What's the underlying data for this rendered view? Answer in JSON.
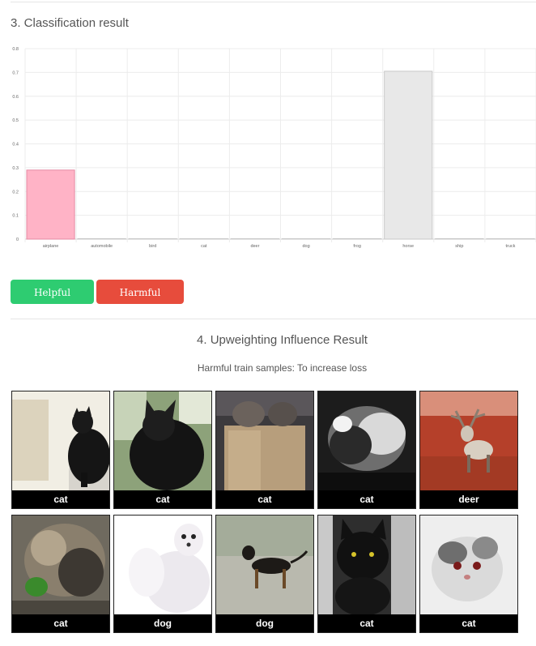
{
  "section3": {
    "title": "3. Classification result"
  },
  "chart_data": {
    "type": "bar",
    "categories": [
      "airplane",
      "automobile",
      "bird",
      "cat",
      "deer",
      "dog",
      "frog",
      "horse",
      "ship",
      "truck"
    ],
    "values": [
      0.29,
      0.002,
      0.0,
      0.0,
      0.0,
      0.0,
      0.002,
      0.705,
      0.002,
      0.0
    ],
    "ylim": [
      0,
      0.8
    ],
    "yticks": [
      "0",
      "0.1",
      "0.2",
      "0.3",
      "0.4",
      "0.5",
      "0.6",
      "0.7",
      "0.8"
    ],
    "bar_colors": [
      "#ffb3c6",
      "#e8e8e8",
      "#e8e8e8",
      "#e8e8e8",
      "#e8e8e8",
      "#e8e8e8",
      "#e8e8e8",
      "#e8e8e8",
      "#e8e8e8",
      "#e8e8e8"
    ],
    "bar_borders": [
      "#e58aa3",
      "#c8c8c8",
      "#c8c8c8",
      "#c8c8c8",
      "#c8c8c8",
      "#c8c8c8",
      "#c8c8c8",
      "#c8c8c8",
      "#c8c8c8",
      "#c8c8c8"
    ],
    "grid": true,
    "title": "",
    "xlabel": "",
    "ylabel": ""
  },
  "buttons": {
    "helpful": "Helpful samples",
    "harmful": "Harmful samples"
  },
  "section4": {
    "title": "4. Upweighting Influence Result",
    "subtitle": "Harmful train samples: To increase loss"
  },
  "samples": [
    {
      "label": "cat"
    },
    {
      "label": "cat"
    },
    {
      "label": "cat"
    },
    {
      "label": "cat"
    },
    {
      "label": "deer"
    },
    {
      "label": "cat"
    },
    {
      "label": "dog"
    },
    {
      "label": "dog"
    },
    {
      "label": "cat"
    },
    {
      "label": "cat"
    }
  ],
  "colors": {
    "helpful_button": "#2ecc71",
    "harmful_button": "#e74c3c"
  }
}
